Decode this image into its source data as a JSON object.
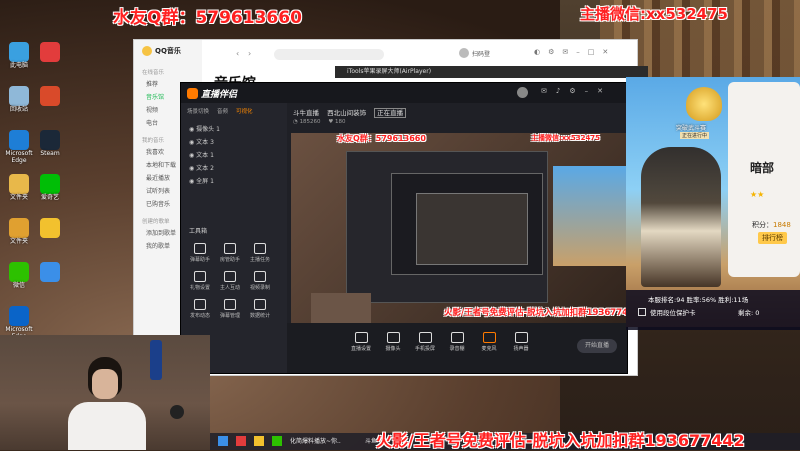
{
  "overlays": {
    "top_left": "水友Q群：579613660",
    "top_right": "主播微信:xx532475",
    "bottom": "火影/王者号免费评估-脱坑入坑加扣群193677442",
    "preview_left": "水友Q群：579613660",
    "preview_right": "主播微信:xx532475",
    "preview_bottom": "火影/王者号免费评估-脱坑入坑加扣群193677442"
  },
  "desktop": {
    "icons": [
      {
        "label": "此电脑",
        "color": "#3aa0e0",
        "icon": "computer-icon"
      },
      {
        "label": "回收站",
        "color": "#8fb8d8",
        "icon": "recycle-bin-icon"
      },
      {
        "label": "Microsoft Edge",
        "color": "#1e7ed6",
        "icon": "edge-icon"
      },
      {
        "label": "文件夹",
        "color": "#e8b84a",
        "icon": "folder-icon"
      },
      {
        "label": "文件夹",
        "color": "#e0a030",
        "icon": "folder-icon"
      },
      {
        "label": "微信",
        "color": "#2dc100",
        "icon": "wechat-icon"
      },
      {
        "label": "Microsoft Edge",
        "color": "#0a64c8",
        "icon": "edge-icon"
      },
      {
        "label": "",
        "color": "#e23c3c",
        "icon": "app-icon"
      },
      {
        "label": "",
        "color": "#d94a2a",
        "icon": "app-icon"
      },
      {
        "label": "Steam",
        "color": "#1b2838",
        "icon": "steam-icon"
      },
      {
        "label": "爱奇艺",
        "color": "#00be06",
        "icon": "iqiyi-icon"
      },
      {
        "label": "",
        "color": "#f2c12e",
        "icon": "app-icon"
      },
      {
        "label": "",
        "color": "#3b8fe8",
        "icon": "app-icon"
      }
    ]
  },
  "qq_music": {
    "app_name": "QQ音乐",
    "page_title": "音乐馆",
    "sidebar_head_1": "在线音乐",
    "sidebar_online": [
      "推荐",
      "音乐馆",
      "视频",
      "电台"
    ],
    "sidebar_head_2": "我的音乐",
    "sidebar_mine": [
      "我喜欢",
      "本地和下载",
      "最近播放",
      "试听列表",
      "已购音乐"
    ],
    "sidebar_head_3": "创建的歌单",
    "sidebar_lists": [
      "添加到歌单",
      "我的歌单"
    ],
    "user": "扫码登"
  },
  "airplayer": {
    "title": "iTools苹果录屏大师(AirPlayer)"
  },
  "stream_app": {
    "brand": "直播伴侣",
    "scene_tabs": [
      "场景切换",
      "音频",
      "可视化"
    ],
    "sources": [
      "摄像头 1",
      "文本 3",
      "文本 1",
      "文本 2",
      "全屏 1"
    ],
    "channel_name": "斗牛直播",
    "category": "西北山间装饰",
    "status_badge": "正在直播",
    "viewers": "185260",
    "fans": "180",
    "tools_label": "工具箱",
    "tools": [
      "弹幕助手",
      "房管助手",
      "主播任务",
      "礼物设置",
      "主人互动",
      "视频录制",
      "发布动态",
      "弹幕管理",
      "数据统计",
      "连麦PK"
    ],
    "bottom_controls": [
      "直播设置",
      "摄像头",
      "手机投屏",
      "录音棚",
      "麦克风",
      "扬声器"
    ],
    "go_live": "开始直播"
  },
  "game": {
    "rank_title": "突破武斗赛",
    "rank_sub": "正在进行中",
    "hero_name": "暗部",
    "score_label": "积分：",
    "score": "1848",
    "rank_btn": "排行榜",
    "stats": "本服排名:94  胜率:56%  胜利:11场",
    "protect": "使用段位保护卡",
    "remain": "剩余: 0"
  },
  "taskbar": {
    "items": [
      "化简爆料播放~你..",
      "斗鱼"
    ]
  },
  "colors": {
    "overlay_red": "#ff2020",
    "qq_green": "#1db954",
    "app_dark": "#1f2026"
  }
}
